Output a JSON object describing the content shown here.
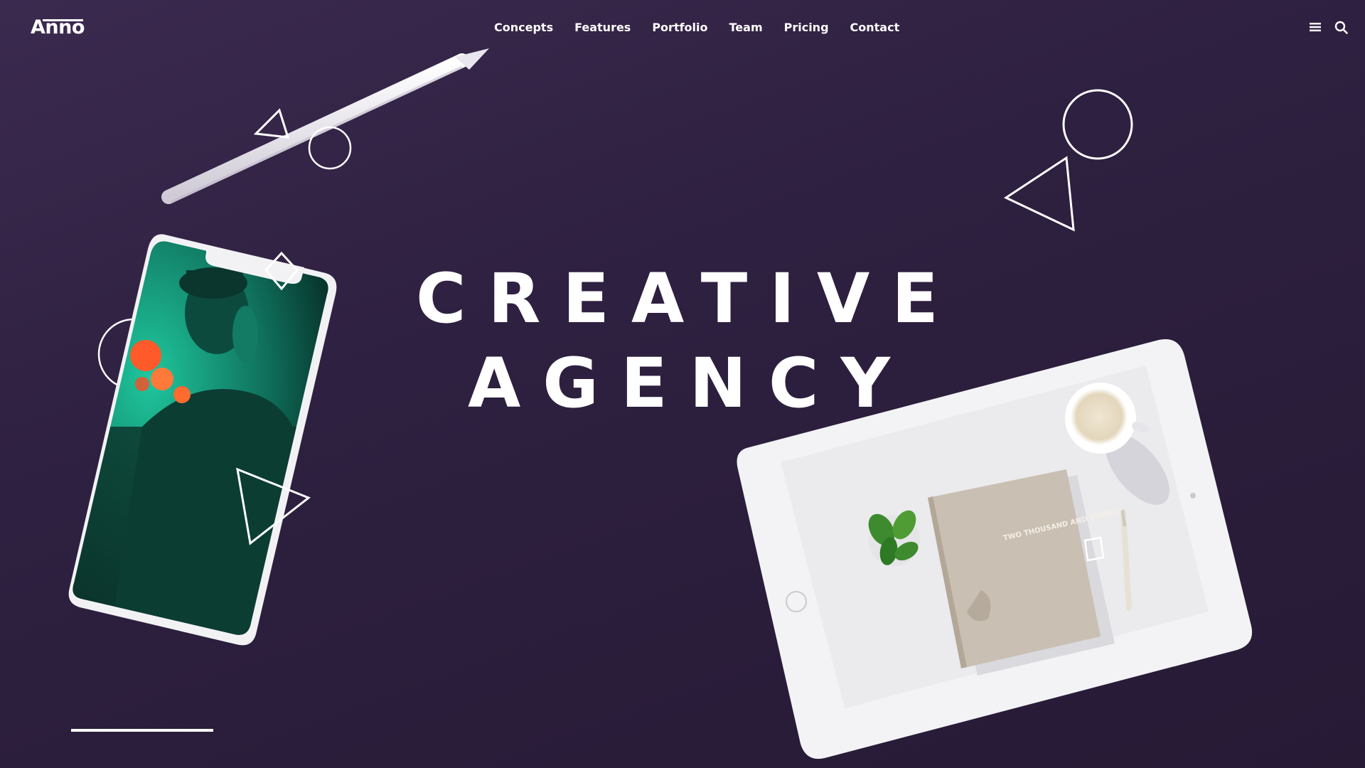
{
  "brand": {
    "logo": "Anno"
  },
  "nav": {
    "items": [
      {
        "label": "Concepts"
      },
      {
        "label": "Features"
      },
      {
        "label": "Portfolio"
      },
      {
        "label": "Team"
      },
      {
        "label": "Pricing"
      },
      {
        "label": "Contact"
      }
    ]
  },
  "header_icons": {
    "menu": "hamburger-menu-icon",
    "search": "search-icon"
  },
  "hero": {
    "line1": "CREATIVE",
    "line2": "AGENCY"
  },
  "book": {
    "cover_text": "TWO THOUSAND AND TWENTY"
  },
  "colors": {
    "background_top": "#3b2a4f",
    "background_bottom": "#261a35",
    "text": "#ffffff",
    "phone_screen_accent": "#1fa88a"
  }
}
